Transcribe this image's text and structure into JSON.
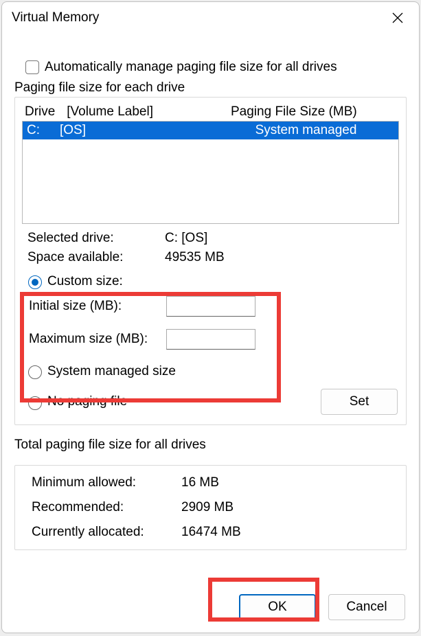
{
  "title": "Virtual Memory",
  "auto_manage_label": "Automatically manage paging file size for all drives",
  "auto_manage_checked": false,
  "group1_label": "Paging file size for each drive",
  "header": {
    "drive": "Drive",
    "volume": "[Volume Label]",
    "size": "Paging File Size (MB)"
  },
  "drives": [
    {
      "drive": "C:",
      "label": "[OS]",
      "size": "System managed",
      "selected": true
    }
  ],
  "selected_drive_label": "Selected drive:",
  "selected_drive_value": "C:  [OS]",
  "space_available_label": "Space available:",
  "space_available_value": "49535 MB",
  "options": {
    "custom": {
      "label": "Custom size:",
      "checked": true
    },
    "initial_label": "Initial size (MB):",
    "initial_value": "",
    "maximum_label": "Maximum size (MB):",
    "maximum_value": "",
    "system": {
      "label": "System managed size",
      "checked": false
    },
    "none": {
      "label": "No paging file",
      "checked": false
    }
  },
  "set_button": "Set",
  "group2_label": "Total paging file size for all drives",
  "minimum_label": "Minimum allowed:",
  "minimum_value": "16 MB",
  "recommended_label": "Recommended:",
  "recommended_value": "2909 MB",
  "allocated_label": "Currently allocated:",
  "allocated_value": "16474 MB",
  "ok_button": "OK",
  "cancel_button": "Cancel"
}
